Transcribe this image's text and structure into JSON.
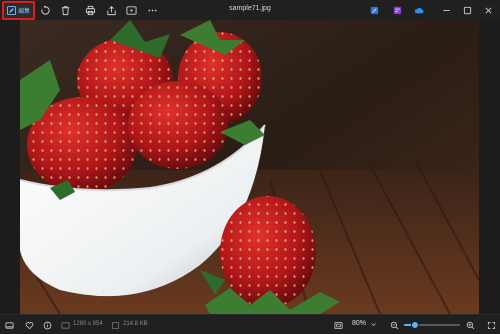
{
  "app": {
    "file_name": "sample71.jpg"
  },
  "toolbar": {
    "edit_label": "編集",
    "icons": [
      "pen-icon",
      "rotate-icon",
      "delete-icon",
      "print-icon",
      "share-icon",
      "slideshow-icon",
      "more-icon"
    ],
    "right_icons": [
      "clipchamp-icon",
      "designer-icon",
      "onedrive-icon"
    ]
  },
  "window_controls": [
    "minimize-icon",
    "maximize-icon",
    "close-icon"
  ],
  "status": {
    "dimensions": "1280 x 854",
    "file_size": "214.8 KB",
    "zoom": "80%",
    "zoom_fraction": 0.2
  },
  "colors": {
    "accent": "#5fb2f2",
    "highlight_border": "#e41b1b"
  }
}
